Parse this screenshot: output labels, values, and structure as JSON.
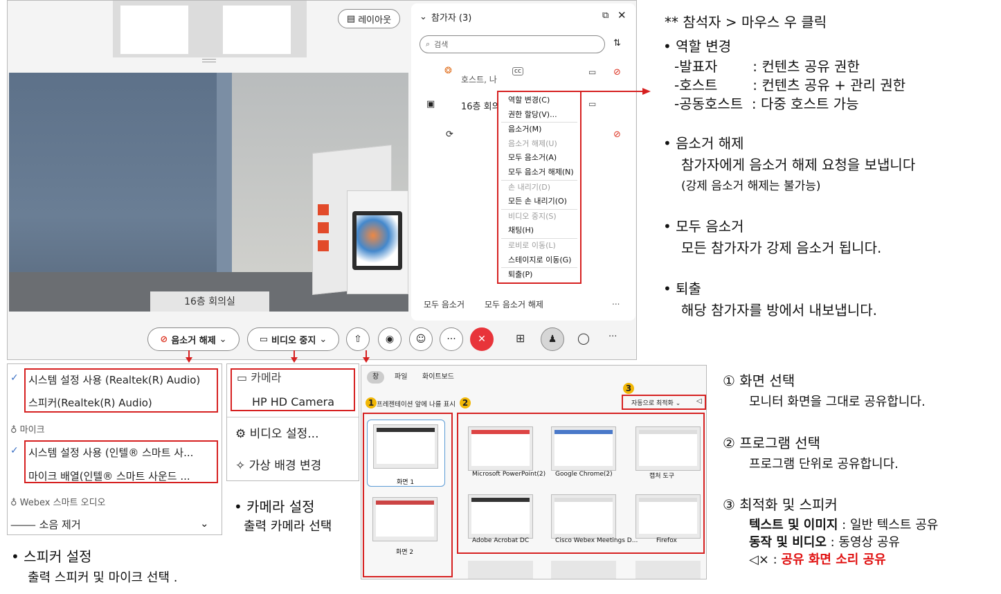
{
  "meeting_window": {
    "layout_button": "레이아웃",
    "room_label": "16층 회의실",
    "participants_panel": {
      "title": "참가자 (3)",
      "search_placeholder": "검색",
      "rows": [
        {
          "name": "호스트, 나"
        },
        {
          "name": "16층 회의"
        },
        {
          "name": ""
        }
      ],
      "footer_mute_all": "모두 음소거",
      "footer_unmute_all": "모두 음소거 해제",
      "footer_more": "..."
    },
    "context_menu": [
      {
        "label": "역할 변경(C)",
        "enabled": true
      },
      {
        "label": "권한 할당(V)...",
        "enabled": true
      },
      {
        "label": "음소거(M)",
        "enabled": true
      },
      {
        "label": "음소거 해제(U)",
        "enabled": false
      },
      {
        "label": "모두 음소거(A)",
        "enabled": true
      },
      {
        "label": "모두 음소거 해제(N)",
        "enabled": true
      },
      {
        "label": "손 내리기(D)",
        "enabled": false
      },
      {
        "label": "모든 손 내리기(O)",
        "enabled": true
      },
      {
        "label": "비디오 중지(S)",
        "enabled": false
      },
      {
        "label": "채팅(H)",
        "enabled": true
      },
      {
        "label": "로비로 이동(L)",
        "enabled": false
      },
      {
        "label": "스테이지로 이동(G)",
        "enabled": true
      },
      {
        "label": "퇴출(P)",
        "enabled": true
      }
    ],
    "controls": {
      "unmute_label": "음소거 해제",
      "stop_video_label": "비디오 중지",
      "more": "···"
    }
  },
  "speaker_panel": {
    "speaker_options": [
      "시스템 설정 사용 (Realtek(R) Audio)",
      "스피커(Realtek(R) Audio)"
    ],
    "mic_header": "마이크",
    "mic_options": [
      "시스템 설정 사용 (인텔® 스마트 사...",
      "마이크 배열(인텔® 스마트 사운드 ..."
    ],
    "smart_audio": "Webex 스마트 오디오",
    "noise_removal": "소음 제거"
  },
  "camera_panel": {
    "camera_header": "카메라",
    "camera_device": "HP HD Camera",
    "video_settings": "비디오 설정...",
    "virtual_background": "가상 배경 변경"
  },
  "share_panel": {
    "tabs": [
      "창",
      "파일",
      "화이트보드"
    ],
    "show_me_label": "프레젠테이션 앞에 나를 표시",
    "optimize_label": "자동으로 최적화",
    "screens": [
      "화면 1",
      "화면 2"
    ],
    "apps": [
      "Microsoft PowerPoint(2)",
      "Google Chrome(2)",
      "캡처 도구",
      "Adobe Acrobat DC",
      "Cisco Webex Meetings D...",
      "Firefox"
    ],
    "badges": [
      "1",
      "2",
      "3"
    ]
  },
  "annotations": {
    "heading": "** 참석자   >   마우스 우 클릭",
    "role_title": "역할 변경",
    "role_lines": [
      "-발표자        : 컨텐츠 공유 권한",
      "-호스트        : 컨텐츠 공유 + 관리 권한",
      "-공동호스트  : 다중 호스트 가능"
    ],
    "unmute_title": "음소거 해제",
    "unmute_line1": "참가자에게 음소거 해제 요청을 보냅니다",
    "unmute_line2": "(강제 음소거 해제는 불가능)",
    "muteall_title": "모두 음소거",
    "muteall_line": "모든 참가자가 강제 음소거 됩니다.",
    "kick_title": "퇴출",
    "kick_line": "해당 참가자를 방에서 내보냅니다.",
    "screen_title": "① 화면 선택",
    "screen_line": "모니터 화면을 그대로 공유합니다.",
    "program_title": "② 프로그램 선택",
    "program_line": "프로그램 단위로 공유합니다.",
    "opt_title": "③ 최적화 및 스피커",
    "opt_text_label": "텍스트 및 이미지",
    "opt_text_desc": " : 일반 텍스트 공유",
    "opt_motion_label": "동작 및 비디오",
    "opt_motion_desc": " : 동영상 공유",
    "opt_sound_prefix": " : ",
    "opt_sound_desc": "공유 화면 소리 공유",
    "speaker_title": "스피커 설정",
    "speaker_line": "출력 스피커 및 마이크 선택 .",
    "camera_title": "카메라 설정",
    "camera_line": "출력 카메라 선택"
  }
}
